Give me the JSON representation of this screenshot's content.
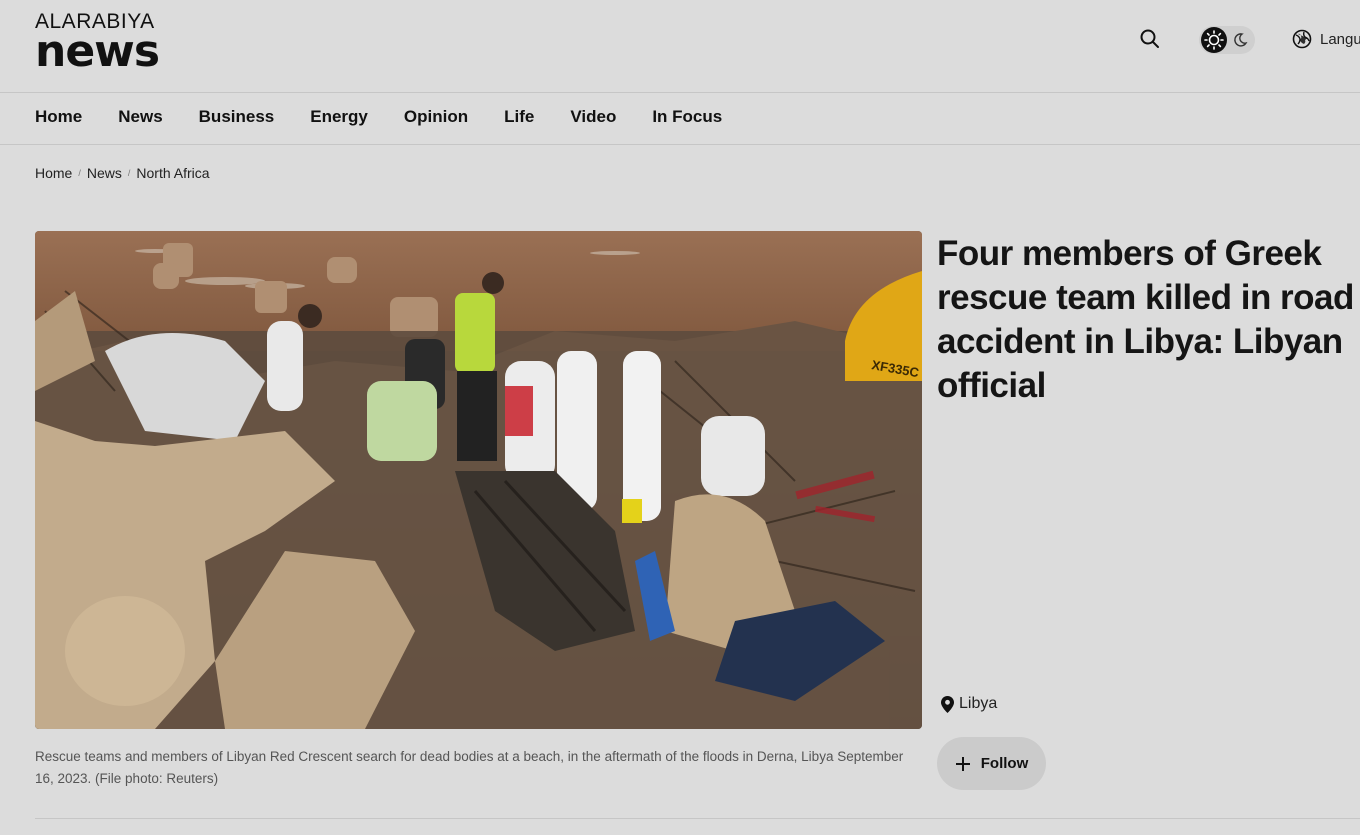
{
  "brand": {
    "logo_top": "ALARABIYA",
    "logo_bottom": "news"
  },
  "header": {
    "language_label": "Langu",
    "icons": [
      "search-icon",
      "sun-icon",
      "moon-icon",
      "globe-icon"
    ]
  },
  "nav": {
    "items": [
      {
        "label": "Home"
      },
      {
        "label": "News"
      },
      {
        "label": "Business"
      },
      {
        "label": "Energy"
      },
      {
        "label": "Opinion"
      },
      {
        "label": "Life"
      },
      {
        "label": "Video"
      },
      {
        "label": "In Focus"
      }
    ]
  },
  "breadcrumb": {
    "items": [
      "Home",
      "News",
      "North Africa"
    ],
    "separator": "/"
  },
  "article": {
    "headline": "Four members of Greek rescue team killed in road accident in Libya: Libyan official",
    "image_caption": "Rescue teams and members of Libyan Red Crescent search for dead bodies at a beach, in the aftermath of the floods in Derna, Libya September 16, 2023. (File photo: Reuters)",
    "location_tag": "Libya",
    "follow_label": "Follow",
    "photo_text": "XF335C"
  },
  "colors": {
    "background": "#dcdcdc",
    "text": "#151515",
    "follow_bg": "#cbcbcb",
    "toggle_active": "#111111"
  }
}
